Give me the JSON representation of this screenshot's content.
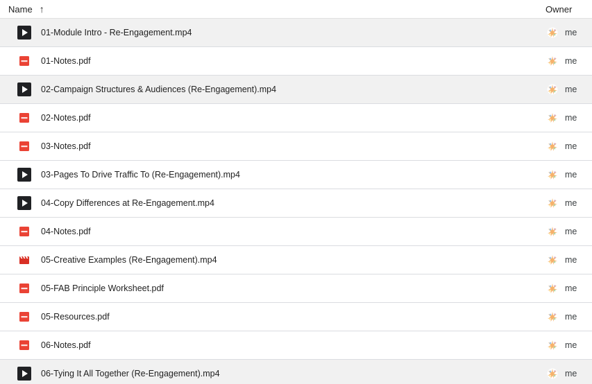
{
  "header": {
    "name_label": "Name",
    "sort_icon": "↑",
    "owner_label": "Owner"
  },
  "files": [
    {
      "name": "01-Module Intro - Re-Engagement.mp4",
      "icon": "video-play-icon",
      "owner": "me",
      "shaded": true
    },
    {
      "name": "01-Notes.pdf",
      "icon": "pdf-icon",
      "owner": "me",
      "shaded": false
    },
    {
      "name": "02-Campaign Structures & Audiences (Re-Engagement).mp4",
      "icon": "video-play-icon",
      "owner": "me",
      "shaded": true
    },
    {
      "name": "02-Notes.pdf",
      "icon": "pdf-icon",
      "owner": "me",
      "shaded": false
    },
    {
      "name": "03-Notes.pdf",
      "icon": "pdf-icon",
      "owner": "me",
      "shaded": false
    },
    {
      "name": "03-Pages To Drive Traffic To (Re-Engagement).mp4",
      "icon": "video-play-icon",
      "owner": "me",
      "shaded": false
    },
    {
      "name": "04-Copy Differences at Re-Engagement.mp4",
      "icon": "video-play-icon",
      "owner": "me",
      "shaded": false
    },
    {
      "name": "04-Notes.pdf",
      "icon": "pdf-icon",
      "owner": "me",
      "shaded": false
    },
    {
      "name": "05-Creative Examples (Re-Engagement).mp4",
      "icon": "movie-clapper-icon",
      "owner": "me",
      "shaded": false
    },
    {
      "name": "05-FAB Principle Worksheet.pdf",
      "icon": "pdf-icon",
      "owner": "me",
      "shaded": false
    },
    {
      "name": "05-Resources.pdf",
      "icon": "pdf-icon",
      "owner": "me",
      "shaded": false
    },
    {
      "name": "06-Notes.pdf",
      "icon": "pdf-icon",
      "owner": "me",
      "shaded": false
    },
    {
      "name": "06-Tying It All Together (Re-Engagement).mp4",
      "icon": "video-play-icon",
      "owner": "me",
      "shaded": true
    }
  ],
  "colors": {
    "pdf": "#ea4335",
    "video": "#202124",
    "clapper": "#d93025"
  }
}
